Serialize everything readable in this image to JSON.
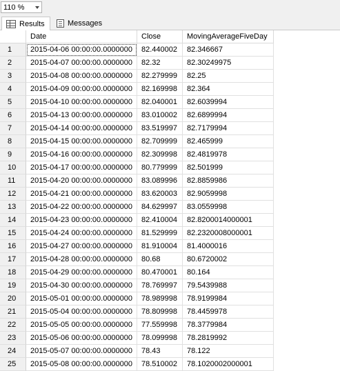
{
  "zoom": {
    "value": "110 %"
  },
  "tabs": {
    "results": "Results",
    "messages": "Messages"
  },
  "columns": {
    "num": "",
    "date": "Date",
    "close": "Close",
    "ma": "MovingAverageFiveDay"
  },
  "rows": [
    {
      "n": "1",
      "date": "2015-04-06 00:00:00.0000000",
      "close": "82.440002",
      "ma": "82.346667"
    },
    {
      "n": "2",
      "date": "2015-04-07 00:00:00.0000000",
      "close": "82.32",
      "ma": "82.30249975"
    },
    {
      "n": "3",
      "date": "2015-04-08 00:00:00.0000000",
      "close": "82.279999",
      "ma": "82.25"
    },
    {
      "n": "4",
      "date": "2015-04-09 00:00:00.0000000",
      "close": "82.169998",
      "ma": "82.364"
    },
    {
      "n": "5",
      "date": "2015-04-10 00:00:00.0000000",
      "close": "82.040001",
      "ma": "82.6039994"
    },
    {
      "n": "6",
      "date": "2015-04-13 00:00:00.0000000",
      "close": "83.010002",
      "ma": "82.6899994"
    },
    {
      "n": "7",
      "date": "2015-04-14 00:00:00.0000000",
      "close": "83.519997",
      "ma": "82.7179994"
    },
    {
      "n": "8",
      "date": "2015-04-15 00:00:00.0000000",
      "close": "82.709999",
      "ma": "82.465999"
    },
    {
      "n": "9",
      "date": "2015-04-16 00:00:00.0000000",
      "close": "82.309998",
      "ma": "82.4819978"
    },
    {
      "n": "10",
      "date": "2015-04-17 00:00:00.0000000",
      "close": "80.779999",
      "ma": "82.501999"
    },
    {
      "n": "11",
      "date": "2015-04-20 00:00:00.0000000",
      "close": "83.089996",
      "ma": "82.8859986"
    },
    {
      "n": "12",
      "date": "2015-04-21 00:00:00.0000000",
      "close": "83.620003",
      "ma": "82.9059998"
    },
    {
      "n": "13",
      "date": "2015-04-22 00:00:00.0000000",
      "close": "84.629997",
      "ma": "83.0559998"
    },
    {
      "n": "14",
      "date": "2015-04-23 00:00:00.0000000",
      "close": "82.410004",
      "ma": "82.8200014000001"
    },
    {
      "n": "15",
      "date": "2015-04-24 00:00:00.0000000",
      "close": "81.529999",
      "ma": "82.2320008000001"
    },
    {
      "n": "16",
      "date": "2015-04-27 00:00:00.0000000",
      "close": "81.910004",
      "ma": "81.4000016"
    },
    {
      "n": "17",
      "date": "2015-04-28 00:00:00.0000000",
      "close": "80.68",
      "ma": "80.6720002"
    },
    {
      "n": "18",
      "date": "2015-04-29 00:00:00.0000000",
      "close": "80.470001",
      "ma": "80.164"
    },
    {
      "n": "19",
      "date": "2015-04-30 00:00:00.0000000",
      "close": "78.769997",
      "ma": "79.5439988"
    },
    {
      "n": "20",
      "date": "2015-05-01 00:00:00.0000000",
      "close": "78.989998",
      "ma": "78.9199984"
    },
    {
      "n": "21",
      "date": "2015-05-04 00:00:00.0000000",
      "close": "78.809998",
      "ma": "78.4459978"
    },
    {
      "n": "22",
      "date": "2015-05-05 00:00:00.0000000",
      "close": "77.559998",
      "ma": "78.3779984"
    },
    {
      "n": "23",
      "date": "2015-05-06 00:00:00.0000000",
      "close": "78.099998",
      "ma": "78.2819992"
    },
    {
      "n": "24",
      "date": "2015-05-07 00:00:00.0000000",
      "close": "78.43",
      "ma": "78.122"
    },
    {
      "n": "25",
      "date": "2015-05-08 00:00:00.0000000",
      "close": "78.510002",
      "ma": "78.1020002000001"
    }
  ]
}
